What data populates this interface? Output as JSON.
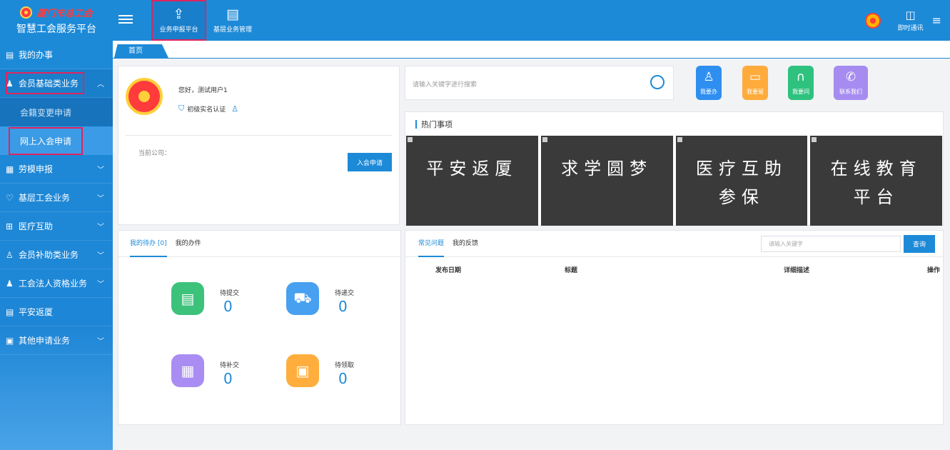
{
  "brand": {
    "org": "厦门市总工会",
    "platform": "智慧工会服务平台"
  },
  "topnav": [
    {
      "label": "业务申报平台",
      "icon": "file-upload-icon",
      "active": true
    },
    {
      "label": "基层业务管理",
      "icon": "clipboard-icon",
      "active": false
    }
  ],
  "topright": {
    "im_label": "即时通讯"
  },
  "sidebar": {
    "items": [
      {
        "label": "我的办事",
        "icon": "document-icon"
      },
      {
        "label": "会员基础类业务",
        "icon": "member-icon",
        "expanded": true
      },
      {
        "label": "劳模申报",
        "icon": "grid-icon"
      },
      {
        "label": "基层工会业务",
        "icon": "heart-icon"
      },
      {
        "label": "医疗互助",
        "icon": "medical-icon"
      },
      {
        "label": "会员补助类业务",
        "icon": "person-icon"
      },
      {
        "label": "工会法人资格业务",
        "icon": "person-badge-icon"
      },
      {
        "label": "平安返厦",
        "icon": "document-icon"
      },
      {
        "label": "其他申请业务",
        "icon": "form-icon"
      }
    ],
    "subitems": [
      {
        "label": "会籍变更申请"
      },
      {
        "label": "网上入会申请"
      }
    ]
  },
  "tabs": {
    "home": "首页"
  },
  "user": {
    "greeting": "您好，测试用户1",
    "certification": "初级实名认证",
    "company_label": "当前公司：",
    "join_button": "入会申请"
  },
  "search": {
    "placeholder": "请输入关键字进行搜索"
  },
  "quick_actions": [
    {
      "label": "我要办",
      "icon": "stamp-icon",
      "color": "#2f8ff0"
    },
    {
      "label": "我要留",
      "icon": "message-icon",
      "color": "#ffab3c"
    },
    {
      "label": "我要问",
      "icon": "headset-icon",
      "color": "#2ec27e"
    },
    {
      "label": "联系我们",
      "icon": "phone-icon",
      "color": "#a68cf0"
    }
  ],
  "hot": {
    "title": "热门事项",
    "items": [
      {
        "line1": "平安返厦",
        "line2": ""
      },
      {
        "line1": "求学圆梦",
        "line2": ""
      },
      {
        "line1": "医疗互助",
        "line2": "参保"
      },
      {
        "line1": "在线教育",
        "line2": "平台"
      }
    ]
  },
  "todo": {
    "tabs": [
      "我的待办 [0]",
      "我的办件"
    ],
    "tiles": [
      {
        "label": "待提交",
        "value": "0",
        "icon": "calendar-doc-icon",
        "color": "#3dc27b"
      },
      {
        "label": "待递交",
        "value": "0",
        "icon": "car-icon",
        "color": "#47a0f0"
      },
      {
        "label": "待补交",
        "value": "0",
        "icon": "calendar-edit-icon",
        "color": "#a98df2"
      },
      {
        "label": "待领取",
        "value": "0",
        "icon": "id-card-icon",
        "color": "#ffae3d"
      }
    ]
  },
  "faq": {
    "tabs": [
      "常见问题",
      "我的反馈"
    ],
    "search_placeholder": "请输入关键字",
    "search_button": "查询",
    "columns": [
      "发布日期",
      "标题",
      "详细描述",
      "操作"
    ]
  }
}
